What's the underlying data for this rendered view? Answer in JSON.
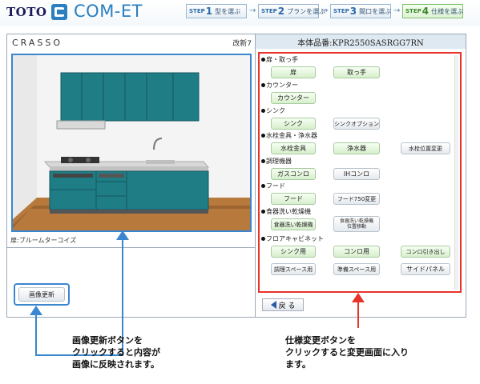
{
  "header": {
    "brand": "TOTO",
    "app_name": "COM-ET",
    "steps": [
      {
        "num": "1",
        "label": "型を選ぶ",
        "prefix": "STEP"
      },
      {
        "num": "2",
        "label": "プランを選ぶ",
        "prefix": "STEP"
      },
      {
        "num": "3",
        "label": "間口を選ぶ",
        "prefix": "STEP"
      },
      {
        "num": "4",
        "label": "仕様を選ぶ",
        "prefix": "STEP"
      }
    ]
  },
  "left": {
    "series": "CRASSO",
    "revision": "改新7",
    "door_label": "扉:ブルームターコイズ",
    "update_button": "画像更新"
  },
  "right": {
    "part_number": "本体品番:KPR2550SASRGG7RN",
    "sections": [
      {
        "title": "扉・取っ手",
        "buttons": [
          "扉",
          "取っ手"
        ]
      },
      {
        "title": "カウンター",
        "buttons": [
          "カウンター"
        ]
      },
      {
        "title": "シンク",
        "buttons": [
          "シンク",
          "シンクオプション"
        ]
      },
      {
        "title": "水栓金具・浄水器",
        "buttons": [
          "水栓金具",
          "浄水器",
          "水栓位置変更"
        ]
      },
      {
        "title": "調理機器",
        "buttons": [
          "ガスコンロ",
          "IHコンロ"
        ]
      },
      {
        "title": "フード",
        "buttons": [
          "フード",
          "フード750変更"
        ]
      },
      {
        "title": "食器洗い乾燥機",
        "buttons": [
          "食器洗い乾燥機",
          "食器洗い乾燥機\n位置移動"
        ]
      },
      {
        "title": "フロアキャビネット",
        "buttons": [
          "シンク用",
          "コンロ用",
          "コンロ引き出し",
          "調理スペース用",
          "準備スペース用",
          "サイドパネル"
        ]
      }
    ],
    "back_button": "戻 る"
  },
  "callouts": {
    "left": "画像更新ボタンを\nクリックすると内容が\n画像に反映されます。",
    "right": "仕様変更ボタンを\nクリックすると変更画面に入り\nます。"
  },
  "colors": {
    "highlight_blue": "#3a86d0",
    "highlight_red": "#e8332a",
    "cabinet_teal": "#1f7d86"
  }
}
